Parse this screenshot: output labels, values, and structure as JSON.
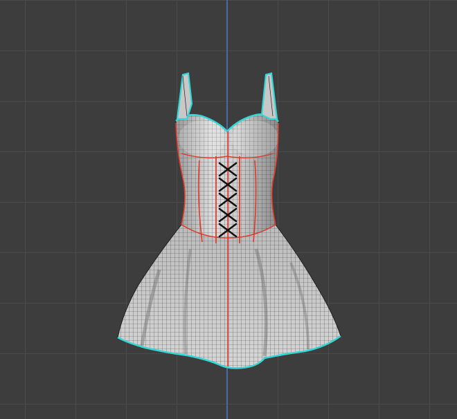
{
  "viewport": {
    "background_color": "#3d3d3d",
    "grid_color": "#4b4b4b",
    "axis_color": "#4b68a8"
  },
  "garment": {
    "object": "corset-dress",
    "fabric_color": "#d2d2d2",
    "wire_color": "#1e1e1e",
    "seam_color": "#e03a2a",
    "boundary_color": "#34d6d6",
    "lacing_color": "#111111"
  }
}
